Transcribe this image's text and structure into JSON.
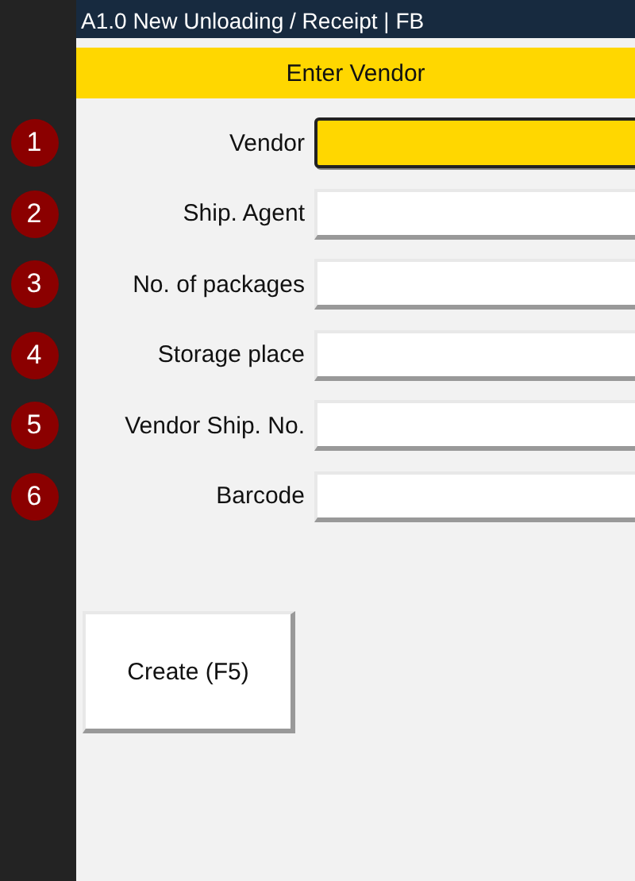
{
  "window": {
    "title": "A1.0 New Unloading / Receipt | FB"
  },
  "header": "Enter Vendor",
  "fields": [
    {
      "number": "1",
      "label": "Vendor",
      "focused": true
    },
    {
      "number": "2",
      "label": "Ship. Agent",
      "focused": false
    },
    {
      "number": "3",
      "label": "No. of packages",
      "focused": false
    },
    {
      "number": "4",
      "label": "Storage place",
      "focused": false
    },
    {
      "number": "5",
      "label": "Vendor Ship. No.",
      "focused": false
    },
    {
      "number": "6",
      "label": "Barcode",
      "focused": false
    }
  ],
  "buttons": [
    "Create (F5)"
  ]
}
